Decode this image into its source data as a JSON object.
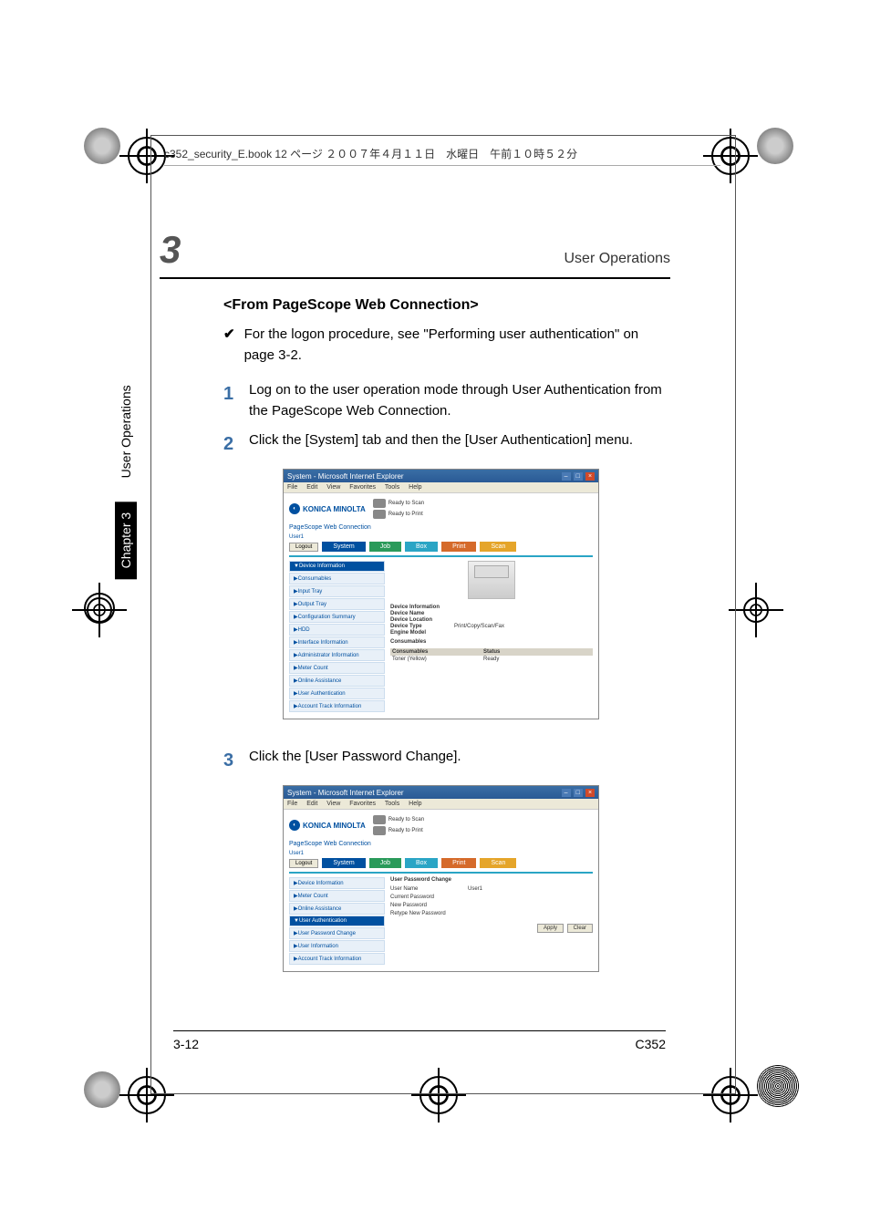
{
  "book_header": "c352_security_E.book  12 ページ  ２００７年４月１１日　水曜日　午前１０時５２分",
  "page_header": {
    "chapter_num": "3",
    "title": "User Operations"
  },
  "side_tab": {
    "chapter": "Chapter 3",
    "title": "User Operations"
  },
  "section_heading": "<From PageScope Web Connection>",
  "check_note": "For the logon procedure, see \"Performing user authentication\" on page 3-2.",
  "steps": {
    "s1": {
      "num": "1",
      "text": "Log on to the user operation mode through User Authentication from the PageScope Web Connection."
    },
    "s2": {
      "num": "2",
      "text": "Click the [System] tab and then the [User Authentication] menu."
    },
    "s3": {
      "num": "3",
      "text": "Click the [User Password Change]."
    }
  },
  "screenshot_common": {
    "window_title": "System - Microsoft Internet Explorer",
    "menubar": {
      "file": "File",
      "edit": "Edit",
      "view": "View",
      "favorites": "Favorites",
      "tools": "Tools",
      "help": "Help"
    },
    "brand": "KONICA MINOLTA",
    "product": "PageScope Web Connection",
    "user_label": "User1",
    "logout": "Logout",
    "status": {
      "scan": "Ready to Scan",
      "print": "Ready to Print"
    },
    "tabs": {
      "system": "System",
      "job": "Job",
      "box": "Box",
      "print": "Print",
      "scan": "Scan"
    }
  },
  "ss1": {
    "sidebar": [
      "▼Device Information",
      "▶Consumables",
      "▶Input Tray",
      "▶Output Tray",
      "▶Configuration Summary",
      "▶HDD",
      "▶Interface Information",
      "▶Administrator Information",
      "▶Meter Count",
      "▶Online Assistance",
      "▶User Authentication",
      "▶Account Track Information"
    ],
    "info_heading": "Device Information",
    "rows": {
      "name": {
        "label": "Device Name",
        "value": ""
      },
      "location": {
        "label": "Device Location",
        "value": ""
      },
      "type": {
        "label": "Device Type",
        "value": "Print/Copy/Scan/Fax"
      },
      "engine": {
        "label": "Engine Model",
        "value": ""
      }
    },
    "consumables": {
      "heading": "Consumables",
      "col1": "Consumables",
      "col2": "Status",
      "row1": {
        "name": "Toner (Yellow)",
        "status": "Ready"
      }
    }
  },
  "ss2": {
    "sidebar": [
      "▶Device Information",
      "▶Meter Count",
      "▶Online Assistance",
      "▼User Authentication",
      "▶User Password Change",
      "▶User Information",
      "▶Account Track Information"
    ],
    "form": {
      "heading": "User Password Change",
      "username": {
        "label": "User Name",
        "value": "User1"
      },
      "current": "Current Password",
      "newpw": "New Password",
      "retype": "Retype New Password",
      "apply": "Apply",
      "clear": "Clear"
    }
  },
  "footer": {
    "page": "3-12",
    "model": "C352"
  }
}
